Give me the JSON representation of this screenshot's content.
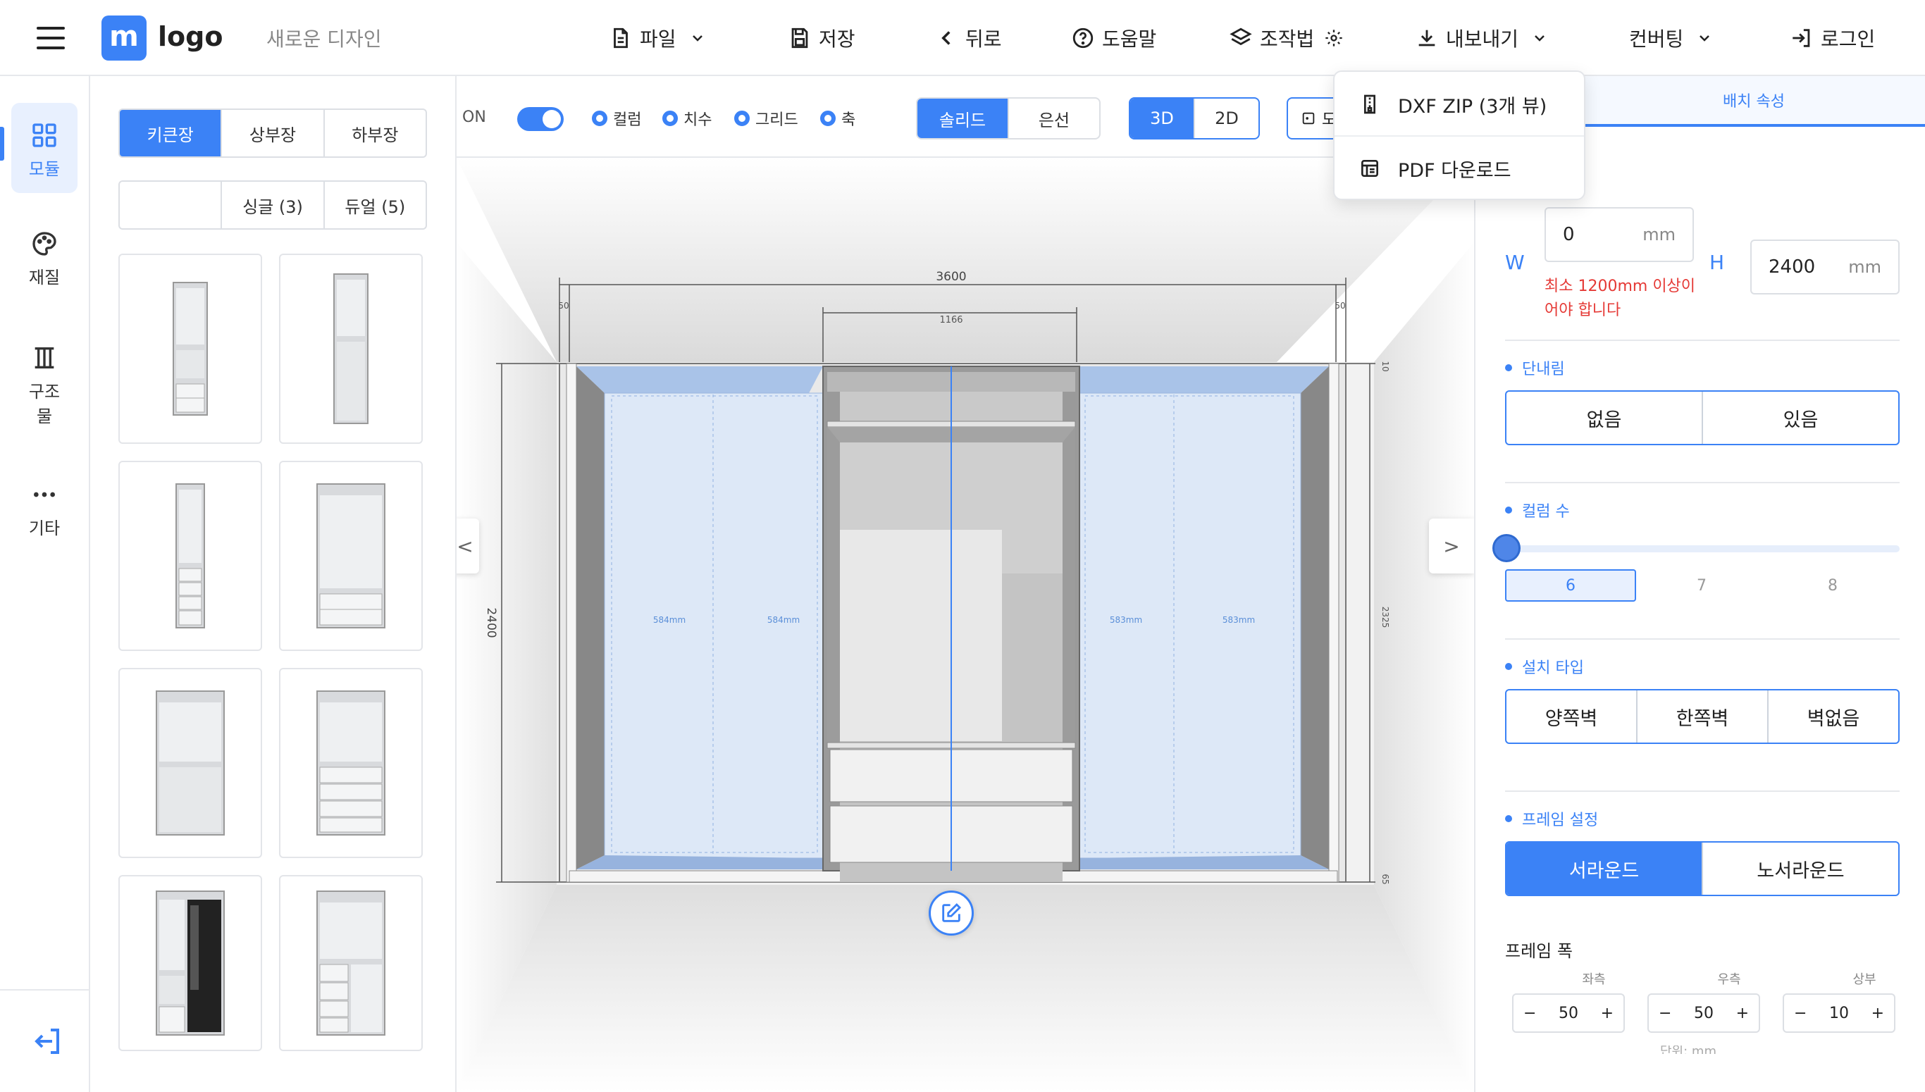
{
  "header": {
    "logo_mark": "m",
    "logo_text": "logo",
    "design_name": "새로운 디자인",
    "menu": {
      "file": "파일",
      "save": "저장",
      "back": "뒤로",
      "help": "도움말",
      "howto": "조작법",
      "export": "내보내기",
      "converting": "컨버팅",
      "login": "로그인"
    }
  },
  "export_dropdown": {
    "items": [
      "DXF ZIP (3개 뷰)",
      "PDF 다운로드"
    ]
  },
  "sidebar": {
    "items": [
      {
        "label": "모듈",
        "icon": "grid-icon",
        "active": true
      },
      {
        "label": "재질",
        "icon": "palette-icon",
        "active": false
      },
      {
        "label": "구조물",
        "icon": "columns-icon",
        "active": false
      },
      {
        "label": "기타",
        "icon": "more-icon",
        "active": false
      }
    ]
  },
  "module_panel": {
    "category_tabs": [
      "키큰장",
      "상부장",
      "하부장"
    ],
    "active_category": "키큰장",
    "filter_tabs": [
      "",
      "싱글 (3)",
      "듀얼 (5)"
    ]
  },
  "toolbar": {
    "toggle_label": "ON",
    "toggle_on": true,
    "radios": [
      "컬럼",
      "치수",
      "그리드",
      "축"
    ],
    "render_modes": [
      "솔리드",
      "은선"
    ],
    "active_render_mode": "솔리드",
    "view_modes": [
      "3D",
      "2D"
    ],
    "active_view_mode": "3D",
    "extra_button_fragment": "도"
  },
  "canvas": {
    "dim_total_width": "3600",
    "dim_left_margin": "50",
    "dim_right_margin": "50",
    "dim_center_width": "1166",
    "dim_height": "2400",
    "dim_top_frame": "10",
    "dim_inner_height": "2325",
    "dim_bottom": "65",
    "column_labels": [
      "584mm",
      "584mm",
      "583mm",
      "583mm"
    ],
    "prev_arrow": "<",
    "next_arrow": ">"
  },
  "right_panel": {
    "tab_label": "배치 속성",
    "width_label": "W",
    "width_value": "0",
    "width_unit": "mm",
    "width_error": "최소 1200mm 이상이어야 합니다",
    "height_label": "H",
    "height_value": "2400",
    "height_unit": "mm",
    "step_section": {
      "title": "단내림",
      "options": [
        "없음",
        "있음"
      ]
    },
    "column_section": {
      "title": "컬럼 수",
      "options": [
        "6",
        "7",
        "8"
      ],
      "selected": "6"
    },
    "install_section": {
      "title": "설치 타입",
      "options": [
        "양쪽벽",
        "한쪽벽",
        "벽없음"
      ]
    },
    "frame_section": {
      "title": "프레임 설정",
      "options": [
        "서라운드",
        "노서라운드"
      ],
      "active": "서라운드"
    },
    "frame_width": {
      "title": "프레임 폭",
      "steppers": [
        {
          "label": "좌측",
          "value": "50"
        },
        {
          "label": "우측",
          "value": "50"
        },
        {
          "label": "상부",
          "value": "10"
        }
      ],
      "footer_fragment": "단위: mm"
    }
  }
}
